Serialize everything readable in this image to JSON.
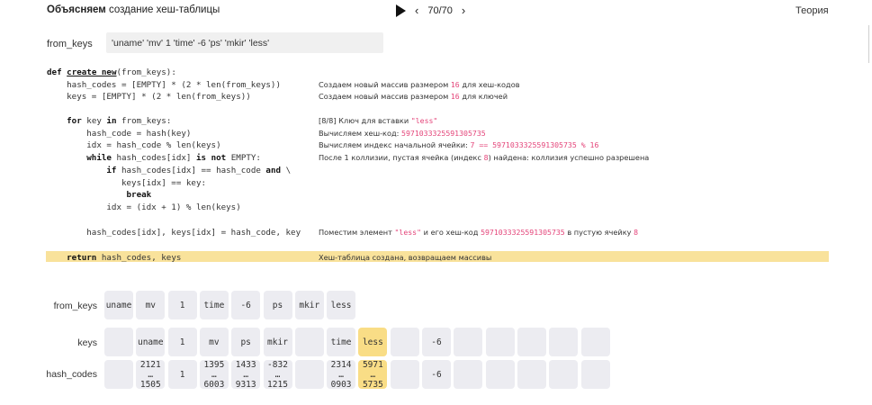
{
  "header": {
    "title_bold": "Объясняем",
    "title_rest": "создание хеш-таблицы",
    "counter": "70/70",
    "theory_label": "Теория"
  },
  "input": {
    "label": "from_keys",
    "value": "'uname' 'mv' 1 'time' -6 'ps' 'mkir' 'less'"
  },
  "code_lines": [
    "def create_new(from_keys):",
    "    hash_codes = [EMPTY] * (2 * len(from_keys))",
    "    keys = [EMPTY] * (2 * len(from_keys))",
    "",
    "    for key in from_keys:",
    "        hash_code = hash(key)",
    "        idx = hash_code % len(keys)",
    "        while hash_codes[idx] is not EMPTY:",
    "            if hash_codes[idx] == hash_code and \\",
    "               keys[idx] == key:",
    "                break",
    "            idx = (idx + 1) % len(keys)",
    "",
    "        hash_codes[idx], keys[idx] = hash_code, key",
    "",
    "    return hash_codes, keys"
  ],
  "explanations": {
    "e1": [
      "Создаем новый массив размером ",
      "16",
      " для хеш-кодов"
    ],
    "e2": [
      "Создаем новый массив размером ",
      "16",
      " для ключей"
    ],
    "e3": [
      "[8/8] Ключ для вставки ",
      "\"less\""
    ],
    "e4": [
      "Вычисляем хеш-код: ",
      "5971033325591305735"
    ],
    "e5": [
      "Вычисляем индекс начальной ячейки: ",
      "7 == 5971033325591305735 % 16"
    ],
    "e6": [
      "После 1 коллизии, пустая ячейка (индекс ",
      "8",
      ") найдена: коллизия успешно разрешена"
    ],
    "e7": [
      "Поместим элемент ",
      "\"less\"",
      " и его хеш-код ",
      "5971033325591305735",
      " в пустую ячейку ",
      "8"
    ],
    "e8": "Хеш-таблица создана, возвращаем массивы"
  },
  "table": {
    "from_keys_label": "from_keys",
    "keys_label": "keys",
    "hash_codes_label": "hash_codes",
    "from_keys": [
      "uname",
      "mv",
      "1",
      "time",
      "-6",
      "ps",
      "mkir",
      "less"
    ],
    "keys": [
      "",
      "uname",
      "1",
      "mv",
      "ps",
      "mkir",
      "",
      "time",
      "less",
      "",
      "-6",
      "",
      "",
      "",
      "",
      ""
    ],
    "hash_codes": [
      [
        "",
        ""
      ],
      [
        "2121",
        "1505"
      ],
      [
        "1",
        ""
      ],
      [
        "1395",
        "6003"
      ],
      [
        "1433",
        "9313"
      ],
      [
        "-832",
        "1215"
      ],
      [
        "",
        ""
      ],
      [
        "2314",
        "0903"
      ],
      [
        "5971",
        "5735"
      ],
      [
        "",
        ""
      ],
      [
        "-6",
        ""
      ],
      [
        "",
        ""
      ],
      [
        "",
        ""
      ],
      [
        "",
        ""
      ],
      [
        "",
        ""
      ],
      [
        "",
        ""
      ]
    ],
    "highlight_index": 8,
    "ellipsis": "…"
  },
  "colors": {
    "highlight": "#f9e29b",
    "cell": "#ececf1",
    "cell_active": "#f9dd86",
    "accent_pink": "#e4457a"
  }
}
